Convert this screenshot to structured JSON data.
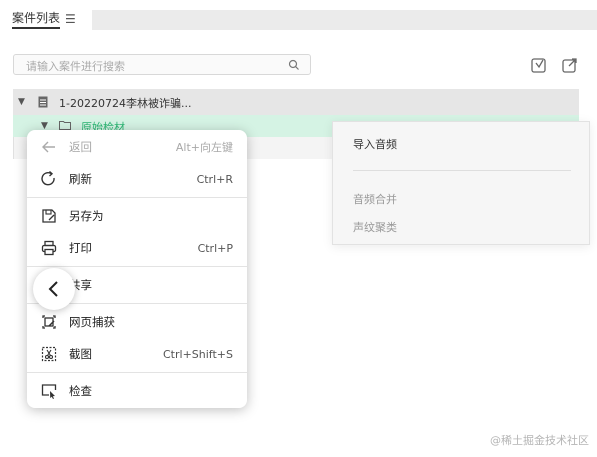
{
  "tabs": {
    "active_label": "案件列表",
    "menu_icon_glyph": "☰"
  },
  "search": {
    "placeholder": "请输入案件进行搜索"
  },
  "tree": {
    "row1_text": "1-20220724李林被诈骗...",
    "row2_text": "原始检材"
  },
  "context_menu": {
    "items": [
      {
        "label": "返回",
        "shortcut": "Alt+向左键",
        "icon": "arrow-left-icon",
        "enabled": false
      },
      {
        "label": "刷新",
        "shortcut": "Ctrl+R",
        "icon": "refresh-icon",
        "enabled": true
      },
      {
        "label": "另存为",
        "shortcut": "",
        "icon": "save-as-icon",
        "enabled": true
      },
      {
        "label": "打印",
        "shortcut": "Ctrl+P",
        "icon": "printer-icon",
        "enabled": true
      },
      {
        "label": "共享",
        "shortcut": "",
        "icon": "share-icon",
        "enabled": true
      },
      {
        "label": "网页捕获",
        "shortcut": "",
        "icon": "web-capture-icon",
        "enabled": true
      },
      {
        "label": "截图",
        "shortcut": "Ctrl+Shift+S",
        "icon": "screenshot-icon",
        "enabled": true
      },
      {
        "label": "检查",
        "shortcut": "",
        "icon": "inspect-icon",
        "enabled": true
      }
    ]
  },
  "submenu": {
    "items": [
      {
        "label": "导入音频",
        "enabled": true
      },
      {
        "label": "音频合并",
        "enabled": false
      },
      {
        "label": "声纹聚类",
        "enabled": false
      }
    ]
  },
  "watermark": "@稀土掘金技术社区",
  "colors": {
    "accent_green": "#2bb673",
    "row_selected": "#d5f3e4"
  }
}
